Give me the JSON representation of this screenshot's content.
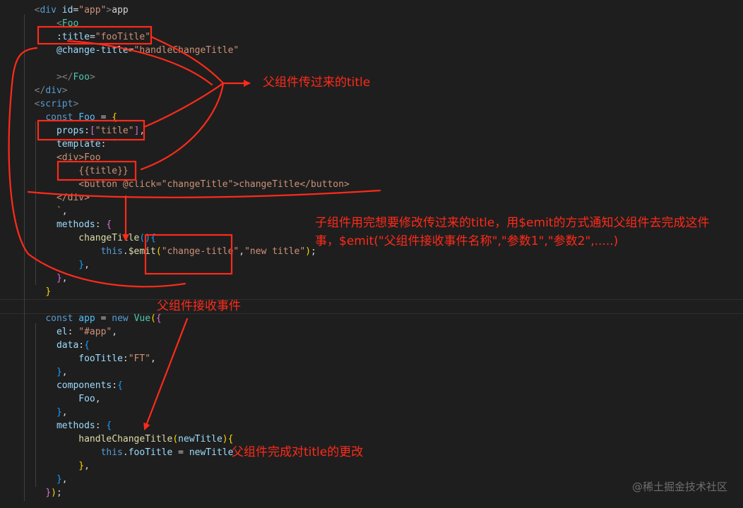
{
  "code_lines": [
    [
      [
        "t-punct",
        "  "
      ],
      [
        "t-punct",
        "<"
      ],
      [
        "t-tag",
        "div"
      ],
      [
        "t-text",
        " "
      ],
      [
        "t-attr",
        "id"
      ],
      [
        "t-text",
        "="
      ],
      [
        "t-str",
        "\"app\""
      ],
      [
        "t-punct",
        ">"
      ],
      [
        "t-text",
        "app"
      ]
    ],
    [
      [
        "t-text",
        "      "
      ],
      [
        "t-punct",
        "<"
      ],
      [
        "t-cls",
        "Foo"
      ]
    ],
    [
      [
        "t-text",
        "      "
      ],
      [
        "t-attr",
        ":title"
      ],
      [
        "t-text",
        "="
      ],
      [
        "t-str",
        "\"fooTitle\""
      ]
    ],
    [
      [
        "t-text",
        "      "
      ],
      [
        "t-attr",
        "@change-title"
      ],
      [
        "t-text",
        "="
      ],
      [
        "t-str",
        "\"handleChangeTitle\""
      ]
    ],
    [
      [
        "t-text",
        ""
      ]
    ],
    [
      [
        "t-text",
        "      "
      ],
      [
        "t-punct",
        "></"
      ],
      [
        "t-cls",
        "Foo"
      ],
      [
        "t-punct",
        ">"
      ]
    ],
    [
      [
        "t-text",
        "  "
      ],
      [
        "t-punct",
        "</"
      ],
      [
        "t-tag",
        "div"
      ],
      [
        "t-punct",
        ">"
      ]
    ],
    [
      [
        "t-text",
        "  "
      ],
      [
        "t-punct",
        "<"
      ],
      [
        "t-tag",
        "script"
      ],
      [
        "t-punct",
        ">"
      ]
    ],
    [
      [
        "t-text",
        "    "
      ],
      [
        "t-kw",
        "const"
      ],
      [
        "t-text",
        " "
      ],
      [
        "t-var",
        "Foo"
      ],
      [
        "t-op",
        " = "
      ],
      [
        "t-br1",
        "{"
      ]
    ],
    [
      [
        "t-text",
        "      "
      ],
      [
        "t-prop",
        "props"
      ],
      [
        "t-op",
        ":"
      ],
      [
        "t-br2",
        "["
      ],
      [
        "t-str",
        "\"title\""
      ],
      [
        "t-br2",
        "]"
      ],
      [
        "t-op",
        ","
      ]
    ],
    [
      [
        "t-text",
        "      "
      ],
      [
        "t-prop",
        "template"
      ],
      [
        "t-op",
        ":"
      ],
      [
        "t-text",
        " "
      ],
      [
        "t-str",
        "`"
      ]
    ],
    [
      [
        "t-text",
        "      "
      ],
      [
        "t-str",
        "<div>Foo"
      ]
    ],
    [
      [
        "t-text",
        "          "
      ],
      [
        "t-str",
        "{{title}}"
      ]
    ],
    [
      [
        "t-text",
        "          "
      ],
      [
        "t-str",
        "<button @click=\"changeTitle\">changeTitle</button>"
      ]
    ],
    [
      [
        "t-text",
        "      "
      ],
      [
        "t-str",
        "</div>"
      ]
    ],
    [
      [
        "t-text",
        "      "
      ],
      [
        "t-str",
        "`"
      ],
      [
        "t-op",
        ","
      ]
    ],
    [
      [
        "t-text",
        "      "
      ],
      [
        "t-prop",
        "methods"
      ],
      [
        "t-op",
        ": "
      ],
      [
        "t-br2",
        "{"
      ]
    ],
    [
      [
        "t-text",
        "          "
      ],
      [
        "t-fn",
        "changeTitle"
      ],
      [
        "t-br3",
        "()"
      ],
      [
        "t-br3",
        "{"
      ]
    ],
    [
      [
        "t-text",
        "              "
      ],
      [
        "t-kw",
        "this"
      ],
      [
        "t-op",
        "."
      ],
      [
        "t-fn",
        "$emit"
      ],
      [
        "t-br1",
        "("
      ],
      [
        "t-str",
        "\"change-title\""
      ],
      [
        "t-op",
        ","
      ],
      [
        "t-str",
        "\"new title\""
      ],
      [
        "t-br1",
        ")"
      ],
      [
        "t-op",
        ";"
      ]
    ],
    [
      [
        "t-text",
        "          "
      ],
      [
        "t-br3",
        "}"
      ],
      [
        "t-op",
        ","
      ]
    ],
    [
      [
        "t-text",
        "      "
      ],
      [
        "t-br2",
        "}"
      ],
      [
        "t-op",
        ","
      ]
    ],
    [
      [
        "t-text",
        "    "
      ],
      [
        "t-br1",
        "}"
      ]
    ],
    [
      [
        "t-text",
        ""
      ]
    ],
    [
      [
        "t-text",
        "    "
      ],
      [
        "t-kw",
        "const"
      ],
      [
        "t-text",
        " "
      ],
      [
        "t-var",
        "app"
      ],
      [
        "t-op",
        " = "
      ],
      [
        "t-kw",
        "new"
      ],
      [
        "t-text",
        " "
      ],
      [
        "t-cls",
        "Vue"
      ],
      [
        "t-br1",
        "("
      ],
      [
        "t-br2",
        "{"
      ]
    ],
    [
      [
        "t-text",
        "      "
      ],
      [
        "t-prop",
        "el"
      ],
      [
        "t-op",
        ": "
      ],
      [
        "t-str",
        "\"#app\""
      ],
      [
        "t-op",
        ","
      ]
    ],
    [
      [
        "t-text",
        "      "
      ],
      [
        "t-prop",
        "data"
      ],
      [
        "t-op",
        ":"
      ],
      [
        "t-br3",
        "{"
      ]
    ],
    [
      [
        "t-text",
        "          "
      ],
      [
        "t-prop",
        "fooTitle"
      ],
      [
        "t-op",
        ":"
      ],
      [
        "t-str",
        "\"FT\""
      ],
      [
        "t-op",
        ","
      ]
    ],
    [
      [
        "t-text",
        "      "
      ],
      [
        "t-br3",
        "}"
      ],
      [
        "t-op",
        ","
      ]
    ],
    [
      [
        "t-text",
        "      "
      ],
      [
        "t-prop",
        "components"
      ],
      [
        "t-op",
        ":"
      ],
      [
        "t-br3",
        "{"
      ]
    ],
    [
      [
        "t-text",
        "          "
      ],
      [
        "t-prop",
        "Foo"
      ],
      [
        "t-op",
        ","
      ]
    ],
    [
      [
        "t-text",
        "      "
      ],
      [
        "t-br3",
        "}"
      ],
      [
        "t-op",
        ","
      ]
    ],
    [
      [
        "t-text",
        "      "
      ],
      [
        "t-prop",
        "methods"
      ],
      [
        "t-op",
        ": "
      ],
      [
        "t-br3",
        "{"
      ]
    ],
    [
      [
        "t-text",
        "          "
      ],
      [
        "t-fn",
        "handleChangeTitle"
      ],
      [
        "t-br1",
        "("
      ],
      [
        "t-prop",
        "newTitle"
      ],
      [
        "t-br1",
        ")"
      ],
      [
        "t-br1",
        "{"
      ]
    ],
    [
      [
        "t-text",
        "              "
      ],
      [
        "t-kw",
        "this"
      ],
      [
        "t-op",
        "."
      ],
      [
        "t-prop",
        "fooTitle"
      ],
      [
        "t-op",
        " = "
      ],
      [
        "t-prop",
        "newTitle"
      ]
    ],
    [
      [
        "t-text",
        "          "
      ],
      [
        "t-br1",
        "}"
      ],
      [
        "t-op",
        ","
      ]
    ],
    [
      [
        "t-text",
        "      "
      ],
      [
        "t-br3",
        "}"
      ],
      [
        "t-op",
        ","
      ]
    ],
    [
      [
        "t-text",
        "    "
      ],
      [
        "t-br2",
        "}"
      ],
      [
        "t-br1",
        ")"
      ],
      [
        "t-op",
        ";"
      ]
    ]
  ],
  "annotations": {
    "parent_title": "父组件传过来的title",
    "child_emit_note": "子组件用完想要修改传过来的title，用$emit的方式通知父组件去完成这件事，$emit(\"父组件接收事件名称\",\"参数1\",\"参数2\",.....)",
    "parent_receive": "父组件接收事件",
    "parent_update": "父组件完成对title的更改"
  },
  "watermark": "@稀土掘金技术社区",
  "colors": {
    "background": "#1e1e1e",
    "annotation_red": "#ff2a1a"
  }
}
